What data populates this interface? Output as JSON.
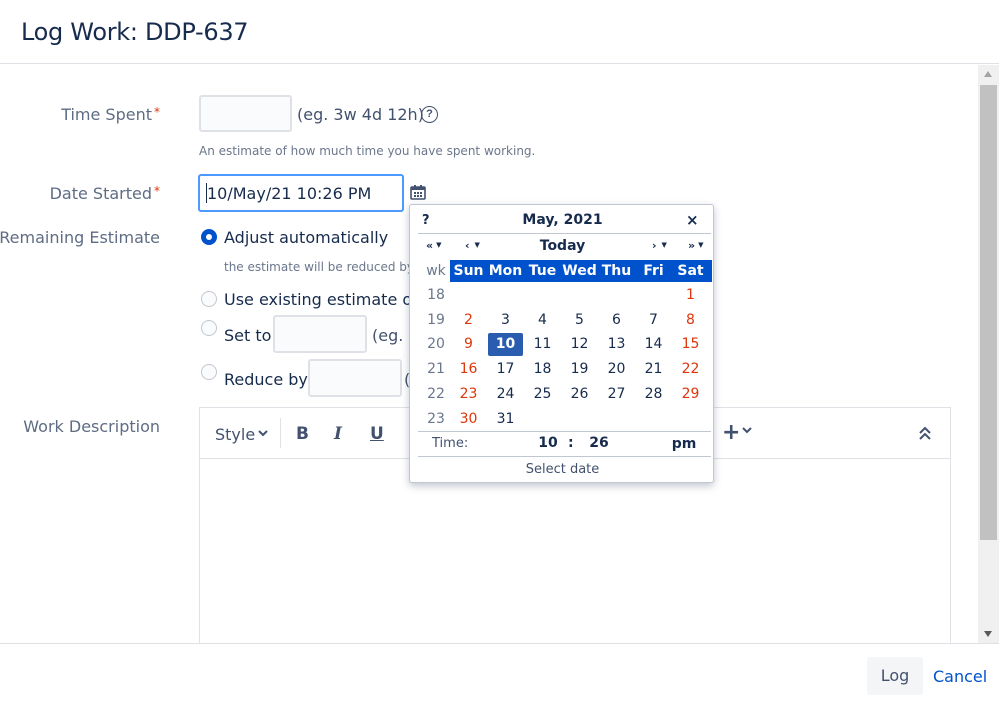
{
  "dialog": {
    "title": "Log Work: DDP-637"
  },
  "form": {
    "time_spent": {
      "label": "Time Spent",
      "required_mark": "*",
      "value": "",
      "format_hint": "(eg. 3w 4d 12h)",
      "description": "An estimate of how much time you have spent working.",
      "help_icon": "?"
    },
    "date_started": {
      "label": "Date Started",
      "required_mark": "*",
      "value": "10/May/21 10:26 PM"
    },
    "remaining_estimate": {
      "label": "Remaining Estimate",
      "options": [
        {
          "label": "Adjust automatically",
          "selected": true,
          "description": "the estimate will be reduced by"
        },
        {
          "label": "Use existing estimate of",
          "selected": false
        },
        {
          "label": "Set to",
          "selected": false,
          "hint": "(eg. 3"
        },
        {
          "label": "Reduce by",
          "selected": false,
          "hint": "("
        }
      ]
    },
    "work_description": {
      "label": "Work Description",
      "toolbar": {
        "style": "Style",
        "bold": "B",
        "italic": "I",
        "underline": "U",
        "insert": "+",
        "collapse_icon": "double-chevron-up-icon"
      }
    }
  },
  "calendar": {
    "help": "?",
    "month_title": "May, 2021",
    "close": "×",
    "prev_year": "«",
    "prev_month": "‹",
    "today": "Today",
    "next_month": "›",
    "next_year": "»",
    "wk_label": "wk",
    "day_names": [
      "Sun",
      "Mon",
      "Tue",
      "Wed",
      "Thu",
      "Fri",
      "Sat"
    ],
    "weeks": [
      {
        "wk": "18",
        "days": [
          "",
          "",
          "",
          "",
          "",
          "",
          "1"
        ]
      },
      {
        "wk": "19",
        "days": [
          "2",
          "3",
          "4",
          "5",
          "6",
          "7",
          "8"
        ]
      },
      {
        "wk": "20",
        "days": [
          "9",
          "10",
          "11",
          "12",
          "13",
          "14",
          "15"
        ]
      },
      {
        "wk": "21",
        "days": [
          "16",
          "17",
          "18",
          "19",
          "20",
          "21",
          "22"
        ]
      },
      {
        "wk": "22",
        "days": [
          "23",
          "24",
          "25",
          "26",
          "27",
          "28",
          "29"
        ]
      },
      {
        "wk": "23",
        "days": [
          "30",
          "31",
          "",
          "",
          "",
          "",
          ""
        ]
      }
    ],
    "selected_day": "10",
    "time_label": "Time:",
    "hour": "10",
    "colon": ":",
    "minute": "26",
    "ampm": "pm",
    "footer": "Select date"
  },
  "footer": {
    "log_button": "Log",
    "cancel_link": "Cancel"
  },
  "colors": {
    "accent": "#0052cc",
    "weekend": "#de350b",
    "selected": "#2a5db0"
  }
}
